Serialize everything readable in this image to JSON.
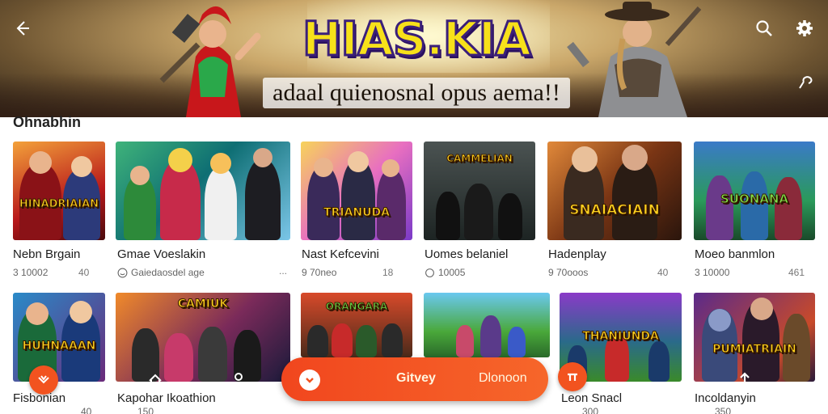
{
  "header": {
    "brand_title": "HIAS.KIA",
    "brand_subtitle": "adaal quienosnal opus aema!!",
    "icons": [
      "back-arrow-icon",
      "search-icon",
      "gear-icon",
      "share-pin-icon"
    ]
  },
  "section": {
    "title": "Ohnabhin"
  },
  "cards_row1": [
    {
      "title": "Nebn Brgain",
      "meta": "3 10002",
      "right": "40",
      "plaque": "HINADRIAIAN"
    },
    {
      "title": "Gmae Voeslakin",
      "meta": "Gaiedaosdel age",
      "right": "...",
      "plaque": ""
    },
    {
      "title": "Nast Kefcevini",
      "meta": "9 70neo",
      "right": "18",
      "plaque": "TRIANUDA"
    },
    {
      "title": "Uomes belaniel",
      "meta": "10005",
      "right": "ᴗ",
      "plaque": "CAMMELIAN"
    },
    {
      "title": "Hadenplay",
      "meta": "9 70ooos",
      "right": "40",
      "plaque": "SNAIACIAIN"
    },
    {
      "title": "Moeo banmlon",
      "meta": "3 10000",
      "right": "461",
      "plaque": "SUONANA"
    }
  ],
  "cards_row2": [
    {
      "title": "Fisbonian",
      "meta": "40",
      "plaque": "HUHNAAAN"
    },
    {
      "title": "Kapohar Ikoathion",
      "meta": "150",
      "plaque": "CAMIUK"
    },
    {
      "title": "",
      "meta": "",
      "plaque": "ORANGARA"
    },
    {
      "title": "",
      "meta": "",
      "plaque": ""
    },
    {
      "title": "Leon Snacl",
      "meta": "300",
      "plaque": "THANIUNDA"
    },
    {
      "title": "Incoldanyin",
      "meta": "350",
      "plaque": "PUMIATRIAIN"
    }
  ],
  "bottom_nav": {
    "primary_label": "Gitvey",
    "secondary_label": "Dlonoon",
    "icons": [
      "home-icon",
      "user-icon",
      "flame-icon",
      "plus-icon",
      "arrow-up-icon"
    ]
  },
  "colors": {
    "accent": "#f2531f",
    "title_yellow": "#f7e11a"
  }
}
